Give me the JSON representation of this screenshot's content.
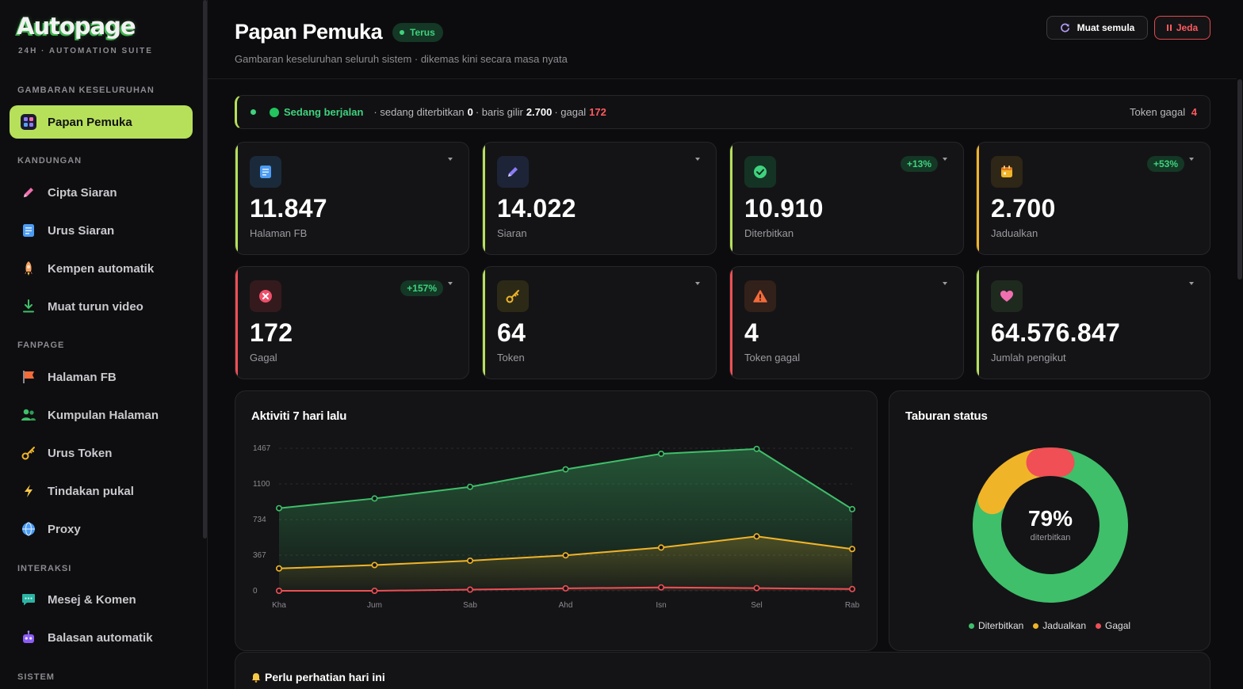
{
  "brand": {
    "name": "Autopage",
    "tagline": "24H · AUTOMATION SUITE"
  },
  "sidebar": {
    "sections": [
      {
        "title": "GAMBARAN KESELURUHAN",
        "items": [
          {
            "label": "Papan Pemuka",
            "icon": "dashboard-grid-icon",
            "active": true
          }
        ]
      },
      {
        "title": "KANDUNGAN",
        "items": [
          {
            "label": "Cipta Siaran",
            "icon": "pencil-icon"
          },
          {
            "label": "Urus Siaran",
            "icon": "document-icon"
          },
          {
            "label": "Kempen automatik",
            "icon": "rocket-icon"
          },
          {
            "label": "Muat turun video",
            "icon": "download-icon"
          }
        ]
      },
      {
        "title": "FANPAGE",
        "items": [
          {
            "label": "Halaman FB",
            "icon": "flag-icon"
          },
          {
            "label": "Kumpulan Halaman",
            "icon": "users-icon"
          },
          {
            "label": "Urus Token",
            "icon": "key-icon"
          },
          {
            "label": "Tindakan pukal",
            "icon": "lightning-icon"
          },
          {
            "label": "Proxy",
            "icon": "globe-icon"
          }
        ]
      },
      {
        "title": "INTERAKSI",
        "items": [
          {
            "label": "Mesej & Komen",
            "icon": "chat-icon"
          },
          {
            "label": "Balasan automatik",
            "icon": "robot-icon"
          }
        ]
      },
      {
        "title": "SISTEM",
        "items": []
      }
    ]
  },
  "header": {
    "title": "Papan Pemuka",
    "badge": "Terus",
    "subtitle": "Gambaran keseluruhan seluruh sistem · dikemas kini secara masa nyata",
    "reload_label": "Muat semula",
    "pause_label": "Jeda"
  },
  "status": {
    "state": "Sedang berjalan",
    "publishing_label": "· sedang diterbitkan",
    "publishing_value": "0",
    "queue_label": "· baris gilir",
    "queue_value": "2.700",
    "failed_label": "· gagal",
    "failed_value": "172",
    "token_fail_label": "Token gagal",
    "token_fail_value": "4"
  },
  "stats": [
    {
      "value": "11.847",
      "label": "Halaman FB",
      "icon": "document-icon",
      "accent": "#b6e05a",
      "icon_bg": "#1b2a3a",
      "delta": ""
    },
    {
      "value": "14.022",
      "label": "Siaran",
      "icon": "pencil-icon",
      "accent": "#b6e05a",
      "icon_bg": "#1e2438",
      "delta": ""
    },
    {
      "value": "10.910",
      "label": "Diterbitkan",
      "icon": "check-circle-icon",
      "accent": "#b6e05a",
      "icon_bg": "#143325",
      "delta": "+13%"
    },
    {
      "value": "2.700",
      "label": "Jadualkan",
      "icon": "calendar-icon",
      "accent": "#f0b429",
      "icon_bg": "#2e2616",
      "delta": "+53%"
    },
    {
      "value": "172",
      "label": "Gagal",
      "icon": "x-circle-icon",
      "accent": "#ef4f55",
      "icon_bg": "#351a1d",
      "delta": "+157%"
    },
    {
      "value": "64",
      "label": "Token",
      "icon": "key-icon",
      "accent": "#b6e05a",
      "icon_bg": "#2c2a17",
      "delta": ""
    },
    {
      "value": "4",
      "label": "Token gagal",
      "icon": "warning-icon",
      "accent": "#ef4f55",
      "icon_bg": "#32201a",
      "delta": ""
    },
    {
      "value": "64.576.847",
      "label": "Jumlah pengikut",
      "icon": "heart-icon",
      "accent": "#b6e05a",
      "icon_bg": "#1f2a1f",
      "delta": ""
    }
  ],
  "activity": {
    "title": "Aktiviti 7 hari lalu",
    "chart_data": {
      "type": "area",
      "categories": [
        "Kha",
        "Jum",
        "Sab",
        "Ahd",
        "Isn",
        "Sel",
        "Rab"
      ],
      "ylim": [
        0,
        1467
      ],
      "yticks": [
        "0",
        "367",
        "734",
        "1100",
        "1467"
      ],
      "series": [
        {
          "color": "#3fbf6a",
          "values": [
            850,
            950,
            1070,
            1250,
            1410,
            1460,
            840
          ]
        },
        {
          "color": "#f0b429",
          "values": [
            230,
            265,
            310,
            365,
            445,
            560,
            430
          ]
        },
        {
          "color": "#ef4f55",
          "values": [
            0,
            0,
            12,
            25,
            35,
            28,
            18
          ]
        }
      ]
    }
  },
  "distribution": {
    "title": "Taburan status",
    "center_value": "79%",
    "center_label": "diterbitkan",
    "chart_data": {
      "type": "pie",
      "labels": [
        "Diterbitkan",
        "Jadualkan",
        "Gagal"
      ],
      "values": [
        79,
        16,
        5
      ],
      "colors": [
        "#3fbf6a",
        "#f0b429",
        "#ef4f55"
      ]
    }
  },
  "attention": {
    "title": "Perlu perhatian hari ini",
    "icon": "bell-icon"
  }
}
